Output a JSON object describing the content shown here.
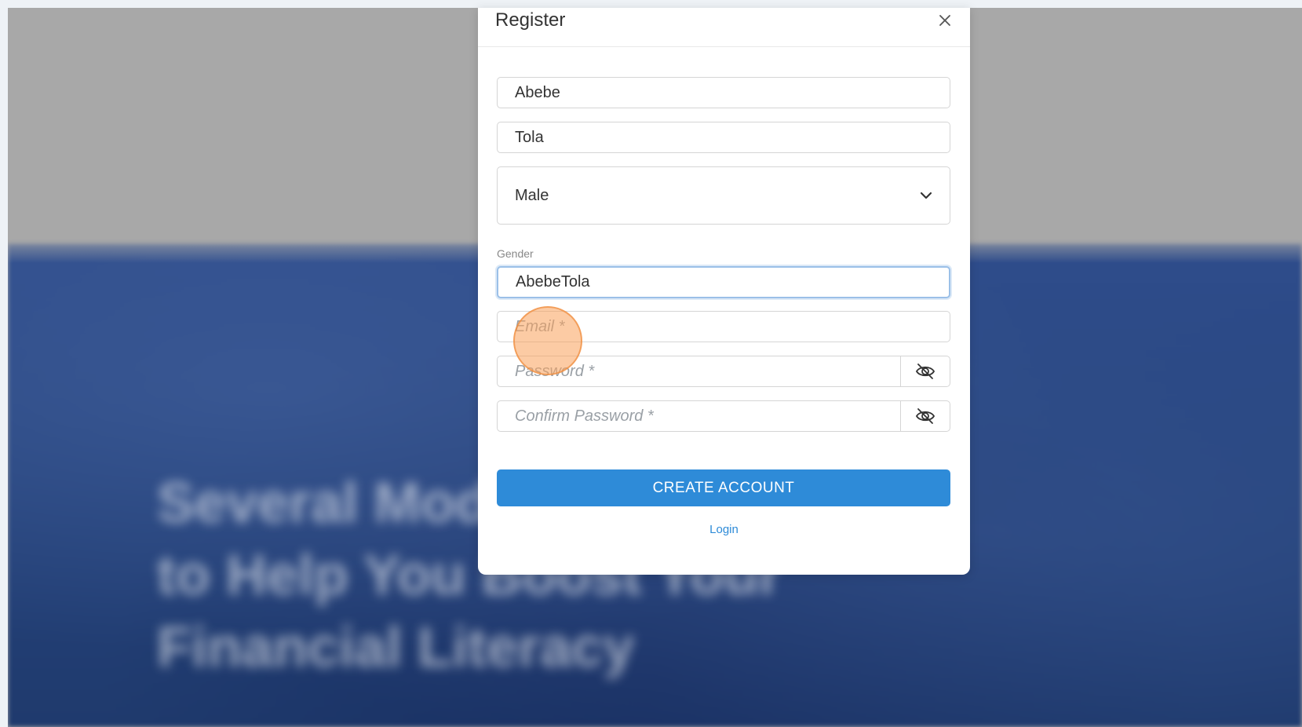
{
  "background": {
    "hero_lines": [
      "Several Modules",
      "to Help You Boost Your",
      "Financial Literacy"
    ]
  },
  "modal": {
    "title": "Register",
    "close_icon": "close-icon",
    "fields": {
      "first_name": {
        "value": "Abebe",
        "placeholder": ""
      },
      "last_name": {
        "value": "Tola",
        "placeholder": ""
      },
      "gender": {
        "selected": "Male",
        "helper": "Gender"
      },
      "username": {
        "value": "AbebeTola",
        "placeholder": ""
      },
      "email": {
        "value": "",
        "placeholder": "Email *"
      },
      "password": {
        "value": "",
        "placeholder": "Password *",
        "toggle_icon": "eye-off-icon"
      },
      "confirm_password": {
        "value": "",
        "placeholder": "Confirm Password *",
        "toggle_icon": "eye-off-icon"
      }
    },
    "create_button": "CREATE ACCOUNT",
    "login_link": "Login"
  },
  "colors": {
    "primary": "#2e8bd8",
    "focus_border": "#9bc0e8",
    "click_marker": "#f5a25d"
  }
}
